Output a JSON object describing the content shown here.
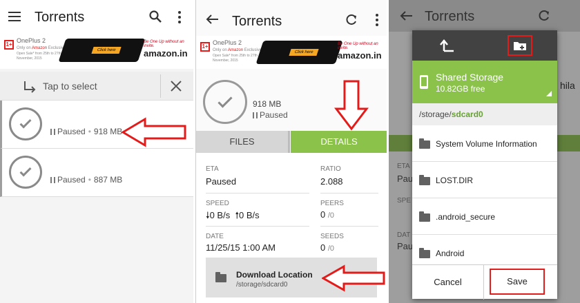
{
  "screen1": {
    "title": "Torrents",
    "select_label": "Tap to select",
    "torrents": [
      {
        "status": "Paused",
        "size": "918 MB"
      },
      {
        "status": "Paused",
        "size": "887 MB"
      }
    ]
  },
  "screen2": {
    "title": "Torrents",
    "header": {
      "size": "918 MB",
      "status": "Paused"
    },
    "tabs": [
      "FILES",
      "DETAILS"
    ],
    "details": {
      "eta_label": "ETA",
      "eta": "Paused",
      "ratio_label": "RATIO",
      "ratio": "2.088",
      "speed_label": "SPEED",
      "down_speed": "0 B/s",
      "up_speed": "0 B/s",
      "peers_label": "PEERS",
      "peers": "0",
      "peers_total": "/0",
      "date_label": "DATE",
      "date": "11/25/15 1:00 AM",
      "seeds_label": "SEEDS",
      "seeds": "0",
      "seeds_total": "/0"
    },
    "download": {
      "title": "Download Location",
      "path": "/storage/sdcard0"
    }
  },
  "screen3": {
    "bg_title": "Torrents",
    "bg_labels": [
      "ETA",
      "Pau",
      "SPE",
      "DAT",
      "Pau"
    ],
    "bg_side": "hila",
    "storage": {
      "name": "Shared Storage",
      "free": "10.82GB free"
    },
    "path_prefix": "/storage/",
    "path_current": "sdcard0",
    "folders": [
      "System Volume Information",
      "LOST.DIR",
      ".android_secure",
      "Android"
    ],
    "cancel": "Cancel",
    "save": "Save"
  },
  "ad": {
    "brand": "OnePlus 2",
    "line1": "Only on",
    "line1b": "Amazon",
    "line1c": "Exclusive",
    "line2": "Open Sale* from 25th to 27th",
    "line3": "November, 2015",
    "btn": "Click here",
    "tag": "Be One Up without an invite.",
    "amazon": "amazon.in"
  },
  "colors": {
    "accent": "#8bc34a",
    "highlight": "#e21b1b",
    "dialog_header": "#424242"
  }
}
